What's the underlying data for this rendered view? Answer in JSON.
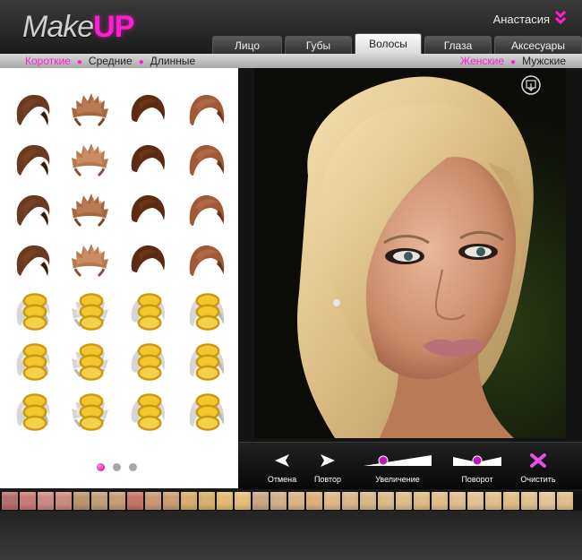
{
  "logo": {
    "make": "Make",
    "up": "UP"
  },
  "user": {
    "name": "Анастасия"
  },
  "tabs": [
    {
      "label": "Лицо",
      "active": false
    },
    {
      "label": "Губы",
      "active": false
    },
    {
      "label": "Волосы",
      "active": true
    },
    {
      "label": "Глаза",
      "active": false
    },
    {
      "label": "Аксесуары",
      "active": false
    }
  ],
  "length_filter": [
    {
      "label": "Короткие",
      "selected": true
    },
    {
      "label": "Средние",
      "selected": false
    },
    {
      "label": "Длинные",
      "selected": false
    }
  ],
  "gender_filter": [
    {
      "label": "Женские",
      "selected": true
    },
    {
      "label": "Мужские",
      "selected": false
    }
  ],
  "hairstyles": {
    "rows": 7,
    "cols": 4,
    "unlocked_rows": 4,
    "locked_indicator": "coin-lock-icon"
  },
  "pager": {
    "pages": 3,
    "current": 1
  },
  "toolbar": {
    "undo": "Отмена",
    "redo": "Повтор",
    "zoom": "Увеличение",
    "rotate": "Поворот",
    "clear": "Очистить"
  },
  "colors": {
    "accent": "#ff1fd0",
    "swatches": [
      "#b36f6e",
      "#c77c78",
      "#c98c88",
      "#d08a83",
      "#b99670",
      "#bfa07b",
      "#c69e7a",
      "#c7726a",
      "#c99a77",
      "#c9a071",
      "#d6b06d",
      "#d8b26c",
      "#e2bc73",
      "#e4c07e",
      "#c8a889",
      "#d0b18a",
      "#d9b689",
      "#dcb27c",
      "#ddbb87",
      "#d9b98c",
      "#d8b98e",
      "#dcbc89",
      "#ddbf8a",
      "#dfbd85",
      "#e1bf8b",
      "#e0c08f",
      "#e2c394",
      "#e2c08c",
      "#dfbf87",
      "#e0c28f",
      "#e3c696",
      "#e1c08d"
    ]
  }
}
